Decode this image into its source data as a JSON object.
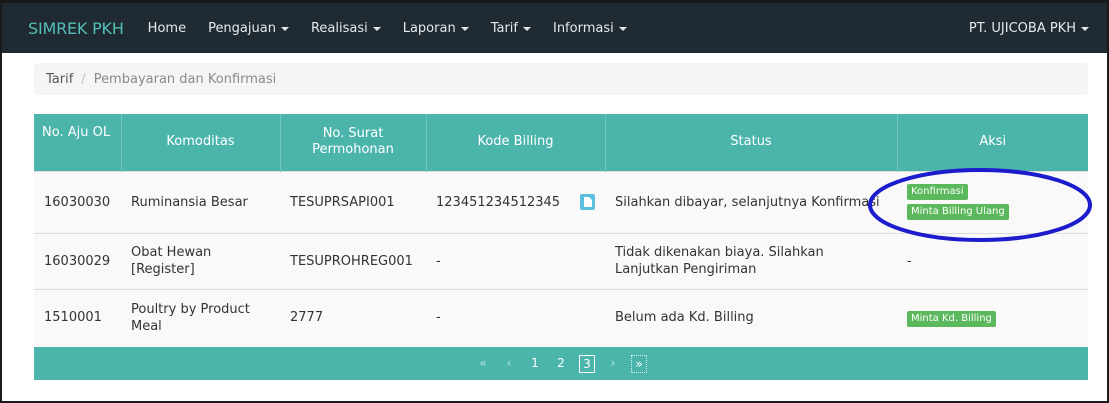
{
  "navbar": {
    "brand": "SIMREK PKH",
    "items": [
      {
        "label": "Home",
        "dropdown": false
      },
      {
        "label": "Pengajuan",
        "dropdown": true
      },
      {
        "label": "Realisasi",
        "dropdown": true
      },
      {
        "label": "Laporan",
        "dropdown": true
      },
      {
        "label": "Tarif",
        "dropdown": true
      },
      {
        "label": "Informasi",
        "dropdown": true
      }
    ],
    "user": "PT. UJICOBA PKH"
  },
  "breadcrumb": {
    "items": [
      "Tarif",
      "Pembayaran dan Konfirmasi"
    ],
    "separator": "/"
  },
  "table": {
    "headers": [
      "No. Aju OL",
      "Komoditas",
      "No. Surat Permohonan",
      "Kode Billing",
      "Status",
      "Aksi"
    ],
    "rows": [
      {
        "no_aju": "16030030",
        "komoditas": "Ruminansia Besar",
        "no_surat": "TESUPRSAPI001",
        "kode_billing": "123451234512345",
        "status": "Silahkan dibayar, selanjutnya Konfirmasi",
        "aksi": [
          "Konfirmasi",
          "Minta Billing Ulang"
        ]
      },
      {
        "no_aju": "16030029",
        "komoditas": "Obat Hewan [Register]",
        "no_surat": "TESUPROHREG001",
        "kode_billing": "-",
        "status": "Tidak dikenakan biaya. Silahkan Lanjutkan Pengiriman",
        "aksi_text": "-"
      },
      {
        "no_aju": "1510001",
        "komoditas": "Poultry by Product Meal",
        "no_surat": "2777",
        "kode_billing": "-",
        "status": "Belum ada Kd. Billing",
        "aksi": [
          "Minta Kd. Billing"
        ]
      }
    ]
  },
  "pagination": {
    "first": "«",
    "prev": "‹",
    "pages": [
      "1",
      "2",
      "3"
    ],
    "current": "3",
    "next": "›",
    "last": "»"
  },
  "colors": {
    "navbar_bg": "#1f2a33",
    "brand": "#55bfb6",
    "table_header": "#4cb5ab",
    "badge_green": "#5cb85c",
    "file_icon": "#5bc0de",
    "annotation_ellipse": "#1c1ccc"
  }
}
